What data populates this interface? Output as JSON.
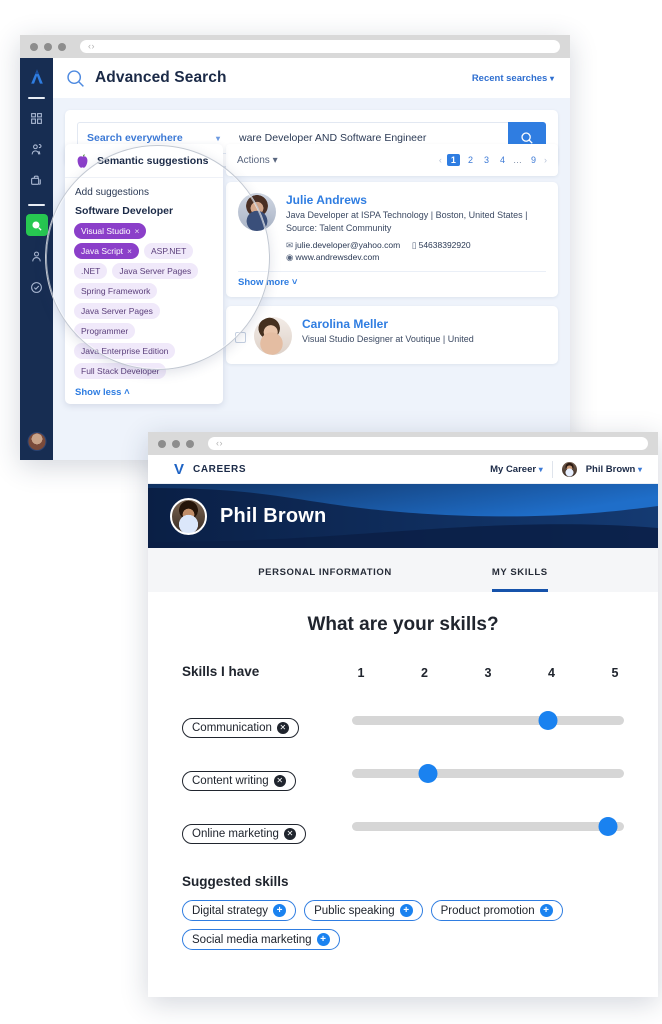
{
  "window1": {
    "chrome": {
      "nav_glyph": "‹ ›"
    },
    "sidebar": {
      "items": [
        {
          "name": "logo",
          "icon": "brand-logo-icon"
        },
        {
          "name": "dashboard",
          "icon": "grid-icon"
        },
        {
          "name": "people",
          "icon": "people-icon"
        },
        {
          "name": "jobs",
          "icon": "briefcase-icon"
        },
        {
          "name": "search",
          "icon": "search-icon",
          "active": true
        },
        {
          "name": "profile",
          "icon": "person-icon"
        },
        {
          "name": "tasks",
          "icon": "check-circle-icon"
        }
      ]
    },
    "header": {
      "title": "Advanced Search",
      "recent_searches": "Recent searches",
      "caret": "▾"
    },
    "search": {
      "scope_label": "Search everywhere",
      "scope_caret": "▾",
      "query": "ware Developer AND Software Engineer",
      "go_icon": "search-icon"
    },
    "toolbar": {
      "actions_label": "Actions",
      "actions_caret": "▾",
      "pager": {
        "prev": "‹",
        "pages": [
          "1",
          "2",
          "3",
          "4"
        ],
        "ellipsis": "…",
        "last": "9",
        "next": "›",
        "current": "1"
      }
    },
    "suggestions": {
      "panel_title": "Semantic suggestions",
      "apple_icon": "apple-icon",
      "add_label": "Add suggestions",
      "group_label": "Software Developer",
      "selected_tags": [
        {
          "label": "Visual Studio",
          "remove": "×"
        },
        {
          "label": "Java Script",
          "remove": "×"
        }
      ],
      "tags": [
        "ASP.NET",
        ".NET",
        "Java Server Pages",
        "Spring Framework",
        "Java Server Pages",
        "Programmer",
        "Java Enterprise Edition",
        "Full Stack Developer"
      ],
      "show_less": "Show less",
      "show_less_caret": "˄"
    },
    "results": [
      {
        "name": "Julie Andrews",
        "meta": "Java Developer at ISPA Technology | Boston, United States | Source: Talent Community",
        "email_icon": "envelope-icon",
        "email": "julie.developer@yahoo.com",
        "phone_icon": "phone-icon",
        "phone": "54638392920",
        "web_icon": "globe-icon",
        "website": "www.andrewsdev.com",
        "show_more": "Show more",
        "show_more_caret": "˅"
      },
      {
        "name": "Carolina Meller",
        "meta": "Visual Studio Designer at Voutique | United"
      }
    ]
  },
  "window2": {
    "chrome": {
      "nav_glyph": "‹ ›"
    },
    "nav": {
      "logo_glyph": "V",
      "brand": "CAREERS",
      "my_career": "My Career",
      "my_career_caret": "▾",
      "user": "Phil Brown",
      "user_caret": "▾",
      "avatar": "user-avatar"
    },
    "banner": {
      "name": "Phil Brown",
      "avatar": "user-avatar"
    },
    "tabs": [
      {
        "label": "PERSONAL INFORMATION",
        "active": false
      },
      {
        "label": "MY SKILLS",
        "active": true
      }
    ],
    "skills": {
      "question": "What are your skills?",
      "have_label": "Skills I have",
      "scale": [
        "1",
        "2",
        "3",
        "4",
        "5"
      ],
      "items": [
        {
          "label": "Communication",
          "remove": "✕",
          "value": 4
        },
        {
          "label": "Content writing",
          "remove": "✕",
          "value": 2
        },
        {
          "label": "Online marketing",
          "remove": "✕",
          "value": 5
        }
      ],
      "suggested_label": "Suggested skills",
      "suggested": [
        {
          "label": "Digital strategy",
          "add": "+"
        },
        {
          "label": "Public speaking",
          "add": "+"
        },
        {
          "label": "Product promotion",
          "add": "+"
        },
        {
          "label": "Social media marketing",
          "add": "+"
        }
      ]
    }
  },
  "colors": {
    "brand_blue": "#2f7de1",
    "navy": "#172d52",
    "banner_dark": "#0a1f45",
    "banner_light": "#1d66c0",
    "accent_green": "#27c851",
    "purple": "#8b3fc9",
    "slider_blue": "#1a82f0"
  }
}
